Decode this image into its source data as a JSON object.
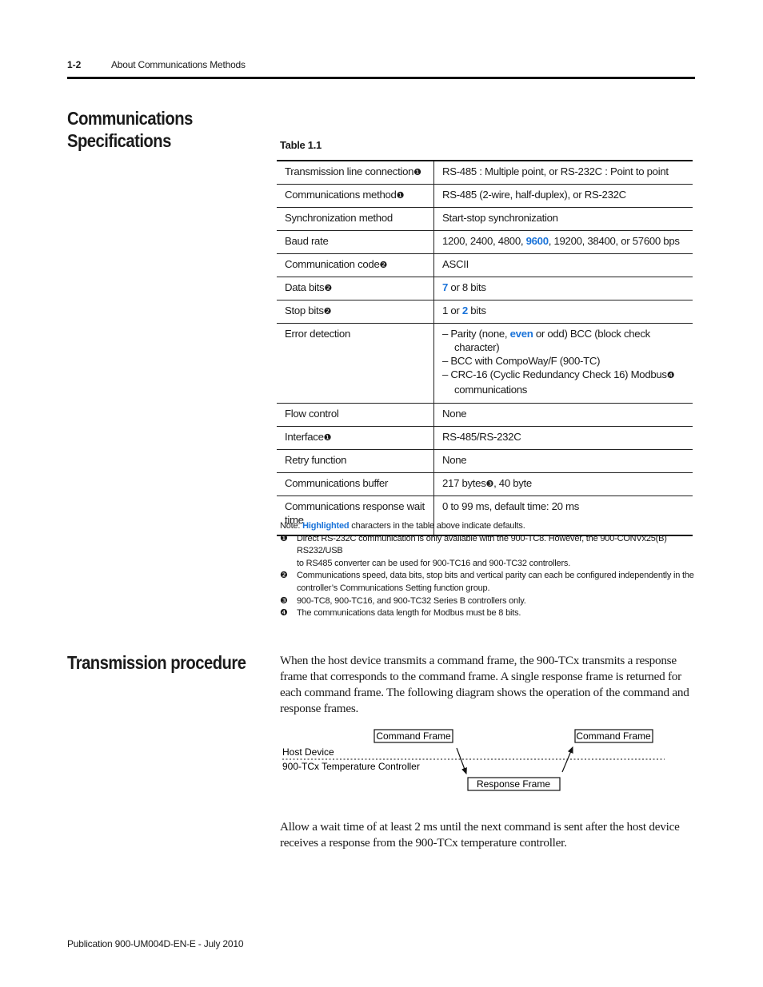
{
  "header": {
    "page_number": "1-2",
    "chapter_title": "About Communications Methods"
  },
  "section1": {
    "heading_line1": "Communications",
    "heading_line2": "Specifications",
    "table_caption": "Table 1.1",
    "rows": [
      {
        "key": "Transmission line connection",
        "key_mark": "❶",
        "value": "RS-485 : Multiple point, or RS-232C : Point to point"
      },
      {
        "key": "Communications method",
        "key_mark": "❶",
        "value": "RS-485 (2-wire, half-duplex), or RS-232C"
      },
      {
        "key": "Synchronization method",
        "key_mark": "",
        "value": "Start-stop synchronization"
      },
      {
        "key": "Baud rate",
        "key_mark": "",
        "value_pre": "1200, 2400, 4800, ",
        "value_hl": "9600",
        "value_post": ", 19200, 38400, or 57600 bps"
      },
      {
        "key": "Communication code",
        "key_mark": "❷",
        "value": "ASCII"
      },
      {
        "key": "Data bits",
        "key_mark": "❷",
        "value_pre": "",
        "value_hl": "7",
        "value_post": " or 8 bits"
      },
      {
        "key": "Stop bits",
        "key_mark": "❷",
        "value_pre": "1 or ",
        "value_hl": "2",
        "value_post": " bits"
      },
      {
        "key": "Error detection",
        "key_mark": "",
        "value_lines": {
          "l1_pre": "–  Parity (none, ",
          "l1_hl": "even",
          "l1_post": " or odd) BCC (block check",
          "l2": "character)",
          "l3": "– BCC with CompoWay/F (900-TC)",
          "l4": "– CRC-16 (Cyclic Redundancy Check 16) Modbus",
          "l4_mark": "❹",
          "l5": "communications"
        }
      },
      {
        "key": "Flow control",
        "key_mark": "",
        "value": "None"
      },
      {
        "key": "Interface",
        "key_mark": "❶",
        "value": "RS-485/RS-232C"
      },
      {
        "key": "Retry function",
        "key_mark": "",
        "value": "None"
      },
      {
        "key": "Communications buffer",
        "key_mark": "",
        "value_pre": "217 bytes",
        "value_mark": "❸",
        "value_post": ", 40 byte"
      },
      {
        "key": "Communications response wait time",
        "key_mark": "",
        "value": "0 to 99 ms, default time: 20 ms"
      }
    ],
    "note": {
      "prefix": "Note: ",
      "highlight": "Highlighted",
      "suffix": " characters in the table above indicate defaults."
    },
    "footnotes": [
      {
        "mark": "❶",
        "lines": [
          "Direct RS-232C communication is only available with the 900-TC8. However, the 900-CONVx25(B) RS232/USB",
          "to RS485 converter can be used for 900-TC16 and 900-TC32 controllers."
        ]
      },
      {
        "mark": "❷",
        "lines": [
          "Communications speed, data bits, stop bits and vertical parity can each be configured independently in the",
          "controller’s Communications Setting function group."
        ]
      },
      {
        "mark": "❸",
        "lines": [
          "900-TC8, 900-TC16, and 900-TC32 Series B controllers only."
        ]
      },
      {
        "mark": "❹",
        "lines": [
          "The communications data length for Modbus must be 8 bits."
        ]
      }
    ]
  },
  "section2": {
    "heading": "Transmission procedure",
    "para1": "When the host device transmits a command frame, the 900-TCx transmits a response frame that corresponds to the command frame. A single response frame is returned for each command frame. The following diagram shows the operation of the command and response frames.",
    "diagram": {
      "command_frame_1": "Command Frame",
      "command_frame_2": "Command Frame",
      "response_frame": "Response Frame",
      "host_label": "Host Device",
      "controller_label": "900-TCx Temperature Controller"
    },
    "para2": "Allow a wait time of at least 2 ms until the next command is sent after the host device receives a response from the 900-TCx temperature controller."
  },
  "footer": {
    "publication": "Publication 900-UM004D-EN-E - July 2010"
  },
  "colors": {
    "highlight": "#1a73d9",
    "text": "#1a1a1a"
  }
}
